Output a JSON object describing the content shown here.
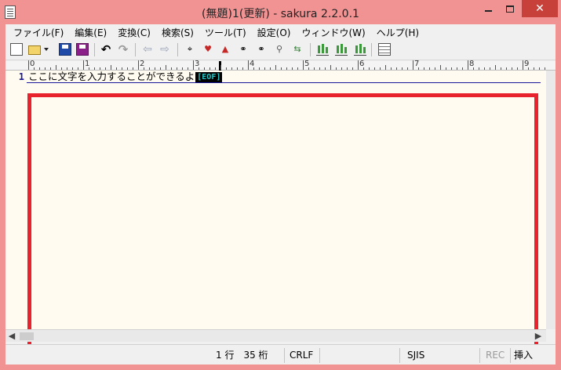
{
  "window": {
    "title": "(無題)1(更新) - sakura 2.2.0.1",
    "minimize_label": "—",
    "maximize_label": "",
    "close_label": "✕"
  },
  "menu": [
    {
      "label": "ファイル(F)"
    },
    {
      "label": "編集(E)"
    },
    {
      "label": "変換(C)"
    },
    {
      "label": "検索(S)"
    },
    {
      "label": "ツール(T)"
    },
    {
      "label": "設定(O)"
    },
    {
      "label": "ウィンドウ(W)"
    },
    {
      "label": "ヘルプ(H)"
    }
  ],
  "toolbar": {
    "undo_glyph": "↶",
    "redo_glyph": "↷",
    "back_glyph": "⇦",
    "forward_glyph": "⇨",
    "find_glyph": "⌖",
    "icons": [
      "new-file-icon",
      "open-folder-icon",
      "dropdown-arrow-icon",
      "save-icon",
      "save-as-icon",
      "undo-icon",
      "redo-icon",
      "back-icon",
      "forward-icon",
      "find-icon",
      "find-next-icon",
      "find-prev-icon",
      "replace-icon",
      "grep-icon",
      "jump-icon",
      "tag-jump-icon",
      "compare-icon",
      "outline-icon",
      "settings-icon"
    ]
  },
  "ruler": {
    "numbers": [
      "0",
      "1",
      "2",
      "3",
      "4",
      "5",
      "6",
      "7",
      "8",
      "9"
    ]
  },
  "editor": {
    "line_number": "1",
    "text": "ここに文字を入力することができるよ",
    "eof_marker": "[EOF]",
    "background": "#fffbf0",
    "highlight_color": "#e8232d"
  },
  "scrollbar": {
    "left_arrow": "◀",
    "right_arrow": "▶"
  },
  "status": {
    "position": "1 行　35 桁",
    "line_ending": "CRLF",
    "encoding": "SJIS",
    "rec": "REC",
    "mode": "挿入"
  }
}
